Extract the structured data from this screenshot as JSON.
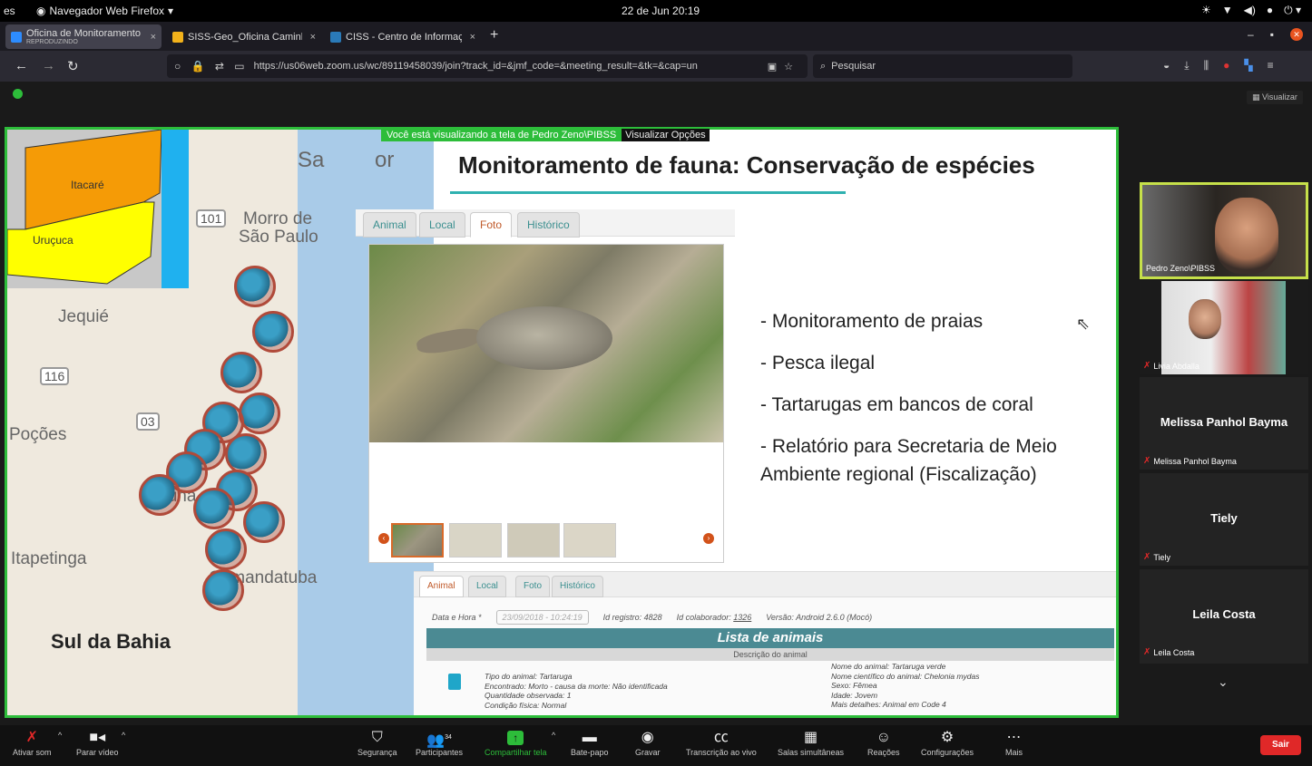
{
  "system": {
    "lang": "es",
    "app_menu": "Navegador Web Firefox",
    "clock": "22 de Jun  20:19"
  },
  "tabs": [
    {
      "title": "Oficina de Monitoramento",
      "subtitle": "REPRODUZINDO",
      "close": "×"
    },
    {
      "title": "SISS-Geo_Oficina Caminh",
      "close": "×"
    },
    {
      "title": "CISS - Centro de Informaç",
      "close": "×"
    }
  ],
  "new_tab": "+",
  "nav": {
    "back": "←",
    "forward": "→",
    "reload": "↻",
    "url": "https://us06web.zoom.us/wc/89119458039/join?track_id=&jmf_code=&meeting_result=&tk=&cap=un",
    "search_placeholder": "Pesquisar"
  },
  "meeting": {
    "view_button": "Visualizar",
    "share_banner": "Você está visualizando a tela de Pedro Zeno\\PIBSS",
    "view_options": "Visualizar Opções"
  },
  "map": {
    "region_itacare": "Itacaré",
    "region_urucuca": "Uruçuca",
    "labels": [
      "Jequié",
      "Poções",
      "Itapetinga",
      "Morro de",
      "São Paulo",
      "Itabuna",
      "Comandatuba",
      "Sa",
      "or"
    ],
    "roads": [
      "101",
      "116",
      "03"
    ],
    "title": "Sul da Bahia",
    "pin_count": 14
  },
  "slide": {
    "title": "Monitoramento de fauna: Conservação de espécies",
    "app_tabs": [
      "Animal",
      "Local",
      "Foto",
      "Histórico"
    ],
    "active_tab": "Foto",
    "bullets": [
      "- Monitoramento de praias",
      "- Pesca ilegal",
      "- Tartarugas em bancos de coral",
      "- Relatório para Secretaria de Meio Ambiente regional (Fiscalização)"
    ]
  },
  "form": {
    "tabs": [
      "Animal",
      "Local",
      "Foto",
      "Histórico"
    ],
    "active_tab": "Animal",
    "date_label": "Data e Hora *",
    "date_value": "23/09/2018 - 10:24:19",
    "id_registro": "Id registro: 4828",
    "id_colaborador_label": "Id colaborador:",
    "id_colaborador_value": "1326",
    "versao": "Versão: Android 2.6.0 (Mocó)",
    "lista_title": "Lista de animais",
    "descricao": "Descrição do animal",
    "left_details": [
      "Tipo do animal: Tartaruga",
      "Encontrado: Morto - causa da morte: Não identificada",
      "Quantidade observada: 1",
      "Condição física: Normal"
    ],
    "right_details": [
      "Nome do animal: Tartaruga verde",
      "Nome científico do animal: Chelonia mydas",
      "Sexo: Fêmea",
      "Idade: Jovem",
      "Mais detalhes: Animal em Code 4"
    ]
  },
  "participants": [
    {
      "name": "Pedro Zeno\\PIBSS",
      "video": true,
      "muted": false
    },
    {
      "name": "Livia Abdalla",
      "video": true,
      "muted": true
    },
    {
      "name": "Melissa Panhol Bayma",
      "video": false,
      "muted": true
    },
    {
      "name": "Tiely",
      "video": false,
      "muted": true
    },
    {
      "name": "Leila Costa",
      "video": false,
      "muted": true
    }
  ],
  "toolbar": {
    "mute": "Ativar som",
    "video": "Parar vídeo",
    "security": "Segurança",
    "participants": "Participantes",
    "participants_count": "34",
    "share": "Compartilhar tela",
    "chat": "Bate-papo",
    "record": "Gravar",
    "transcription": "Transcrição ao vivo",
    "breakout": "Salas simultâneas",
    "reactions": "Reações",
    "settings": "Configurações",
    "more": "Mais",
    "leave": "Sair"
  },
  "colors": {
    "share_border": "#2dbd3a",
    "leave": "#e02828",
    "active_speaker": "#c6e04a",
    "accent_teal": "#2fb1b0"
  }
}
